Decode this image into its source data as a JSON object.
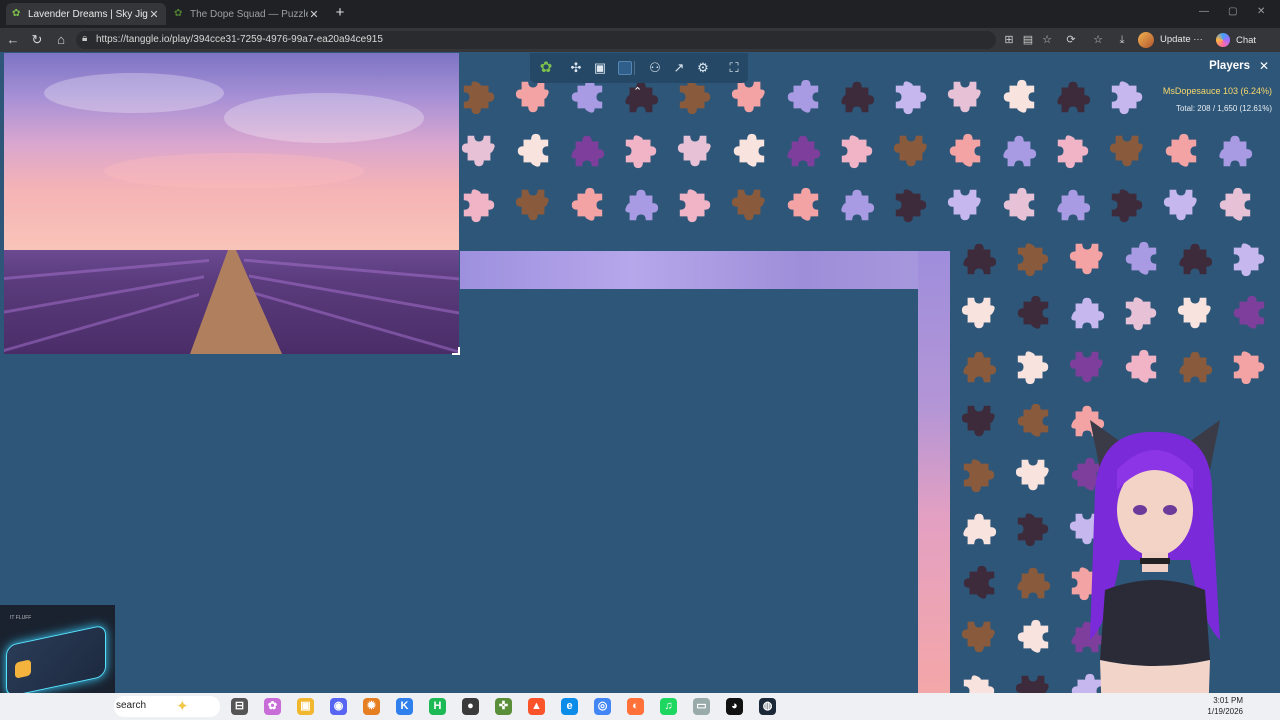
{
  "browser": {
    "tabs": [
      {
        "title": "Lavender Dreams | Sky Jigsaw",
        "active": true
      },
      {
        "title": "The Dope Squad — Puzzles",
        "active": false
      }
    ],
    "url": "https://tanggle.io/play/394cce31-7259-4976-99a7-ea20a94ce915",
    "update_label": "Update ···",
    "chat_label": "Chat",
    "icons": [
      "back-icon",
      "refresh-icon",
      "home-icon",
      "lock-icon",
      "split-screen-icon",
      "reading-mode-icon",
      "star-icon",
      "extensions-icon",
      "favorites-icon",
      "download-icon",
      "copilot-icon"
    ]
  },
  "puzzle": {
    "toolbar_icons": [
      "tanggle-logo-icon",
      "puzzle-piece-icon",
      "image-preview-icon",
      "background-color-icon",
      "players-icon",
      "share-icon",
      "settings-icon",
      "fullscreen-icon"
    ],
    "background_color": "#2e5678"
  },
  "players": {
    "header": "Players",
    "list": [
      {
        "name": "MsDopesauce",
        "score": "103 (6.24%)"
      }
    ],
    "total": "Total: 208 / 1,650 (12.61%)"
  },
  "taskbar": {
    "search_placeholder": "search",
    "time": "3:01 PM",
    "date": "1/19/2026",
    "apps": [
      "task-view",
      "copilot",
      "file-explorer",
      "discord",
      "app",
      "kodi",
      "hbo",
      "obs",
      "app",
      "brave",
      "edge",
      "chrome",
      "firefox",
      "spotify",
      "app",
      "github",
      "steam"
    ]
  },
  "widget": {
    "label": "IT FLUFF"
  }
}
